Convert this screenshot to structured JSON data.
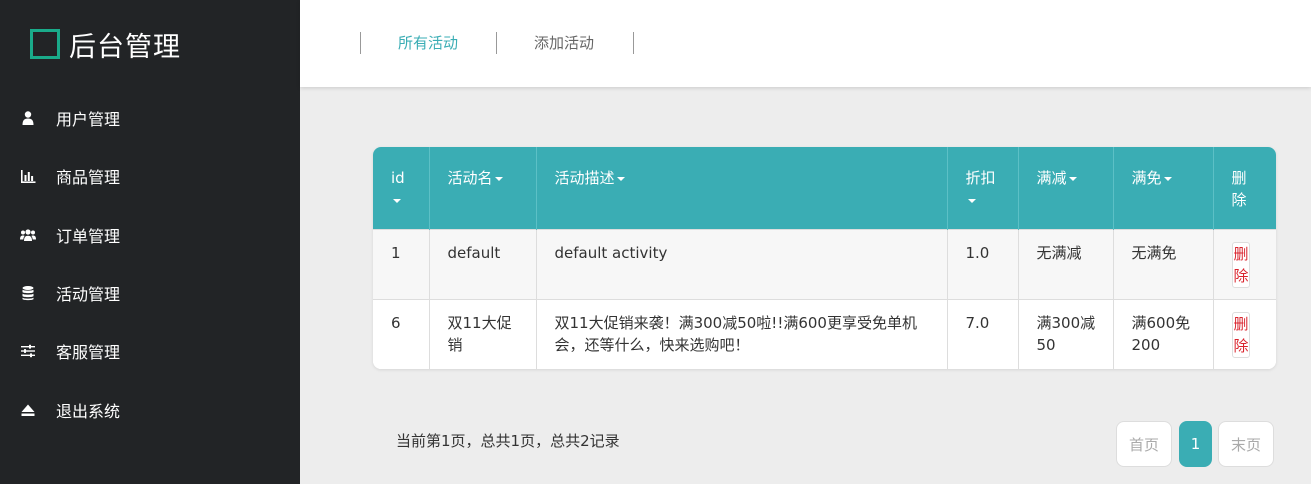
{
  "brand": {
    "title": "后台管理",
    "accent": "#1aab8a"
  },
  "sidebar": {
    "items": [
      {
        "label": "用户管理",
        "icon": "user-icon"
      },
      {
        "label": "商品管理",
        "icon": "bar-chart-icon"
      },
      {
        "label": "订单管理",
        "icon": "users-icon"
      },
      {
        "label": "活动管理",
        "icon": "database-icon"
      },
      {
        "label": "客服管理",
        "icon": "sliders-icon"
      },
      {
        "label": "退出系统",
        "icon": "eject-icon"
      }
    ]
  },
  "tabs": [
    {
      "label": "所有活动",
      "active": true
    },
    {
      "label": "添加活动",
      "active": false
    }
  ],
  "table": {
    "header_color": "#3aadb4",
    "columns": [
      "id",
      "活动名",
      "活动描述",
      "折扣",
      "满减",
      "满免",
      "删除"
    ],
    "rows": [
      {
        "id": "1",
        "name": "default",
        "desc": "default activity",
        "discount": "1.0",
        "full_reduce": "无满减",
        "full_free": "无满免",
        "delete": "删除"
      },
      {
        "id": "6",
        "name": "双11大促销",
        "desc": "双11大促销来袭！满300减50啦!!满600更享受免单机会，还等什么，快来选购吧！",
        "discount": "7.0",
        "full_reduce": "满300减50",
        "full_free": "满600免200",
        "delete": "删除"
      }
    ]
  },
  "pagination": {
    "info": "当前第1页，总共1页，总共2记录",
    "first": "首页",
    "current": "1",
    "last": "末页"
  }
}
